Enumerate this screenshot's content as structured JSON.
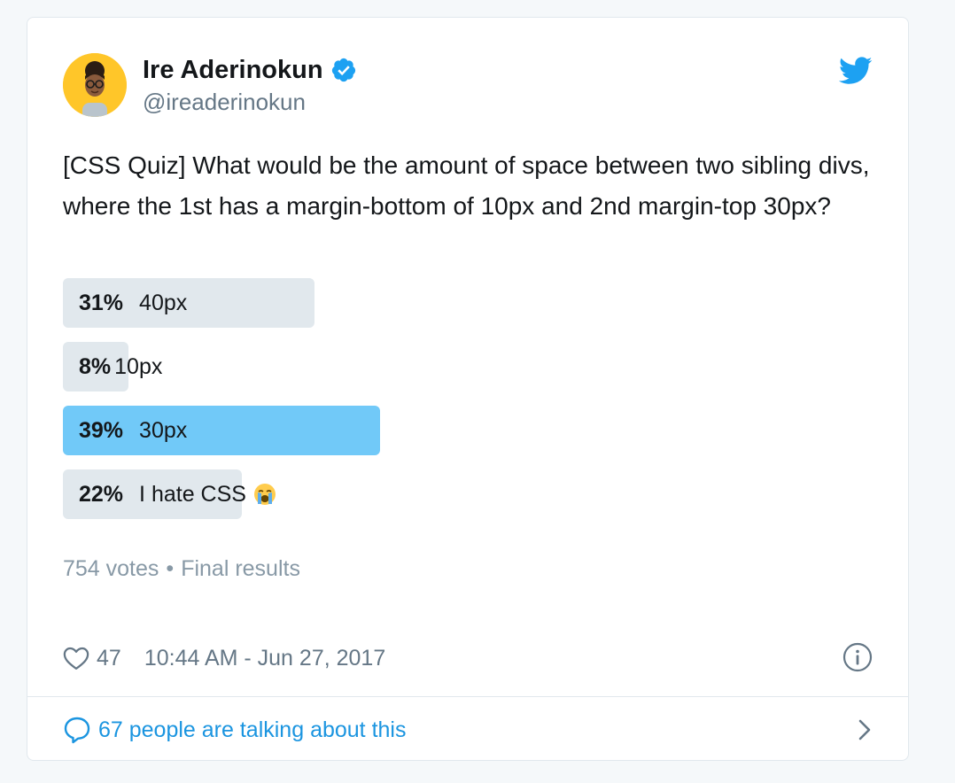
{
  "author": {
    "display_name": "Ire Aderinokun",
    "handle": "@ireaderinokun"
  },
  "tweet": {
    "text": "[CSS Quiz] What would be the amount of space between two sibling divs, where the 1st has a margin-bottom of 10px and 2nd margin-top 30px?"
  },
  "poll": {
    "options": [
      {
        "percent_label": "31%",
        "percent": 31,
        "label": "40px",
        "winner": false
      },
      {
        "percent_label": "8%",
        "percent": 8,
        "label": "10px",
        "winner": false
      },
      {
        "percent_label": "39%",
        "percent": 39,
        "label": "30px",
        "winner": true
      },
      {
        "percent_label": "22%",
        "percent": 22,
        "label": "I hate CSS",
        "winner": false,
        "emoji": "loudly-crying-face"
      }
    ],
    "votes": "754 votes",
    "separator": "•",
    "status": "Final results"
  },
  "footer": {
    "likes": "47",
    "timestamp": "10:44 AM - Jun 27, 2017",
    "conversation": "67 people are talking about this"
  },
  "colors": {
    "accent": "#1da1f2",
    "link": "#1b95e0",
    "poll_bar": "#e1e8ed",
    "poll_bar_winner": "#71c9f8"
  },
  "icons": {
    "verified": "verified-badge-icon",
    "brand": "twitter-bird-icon",
    "like": "heart-icon",
    "info": "info-icon",
    "conversation": "speech-bubble-icon",
    "more": "chevron-right-icon"
  }
}
